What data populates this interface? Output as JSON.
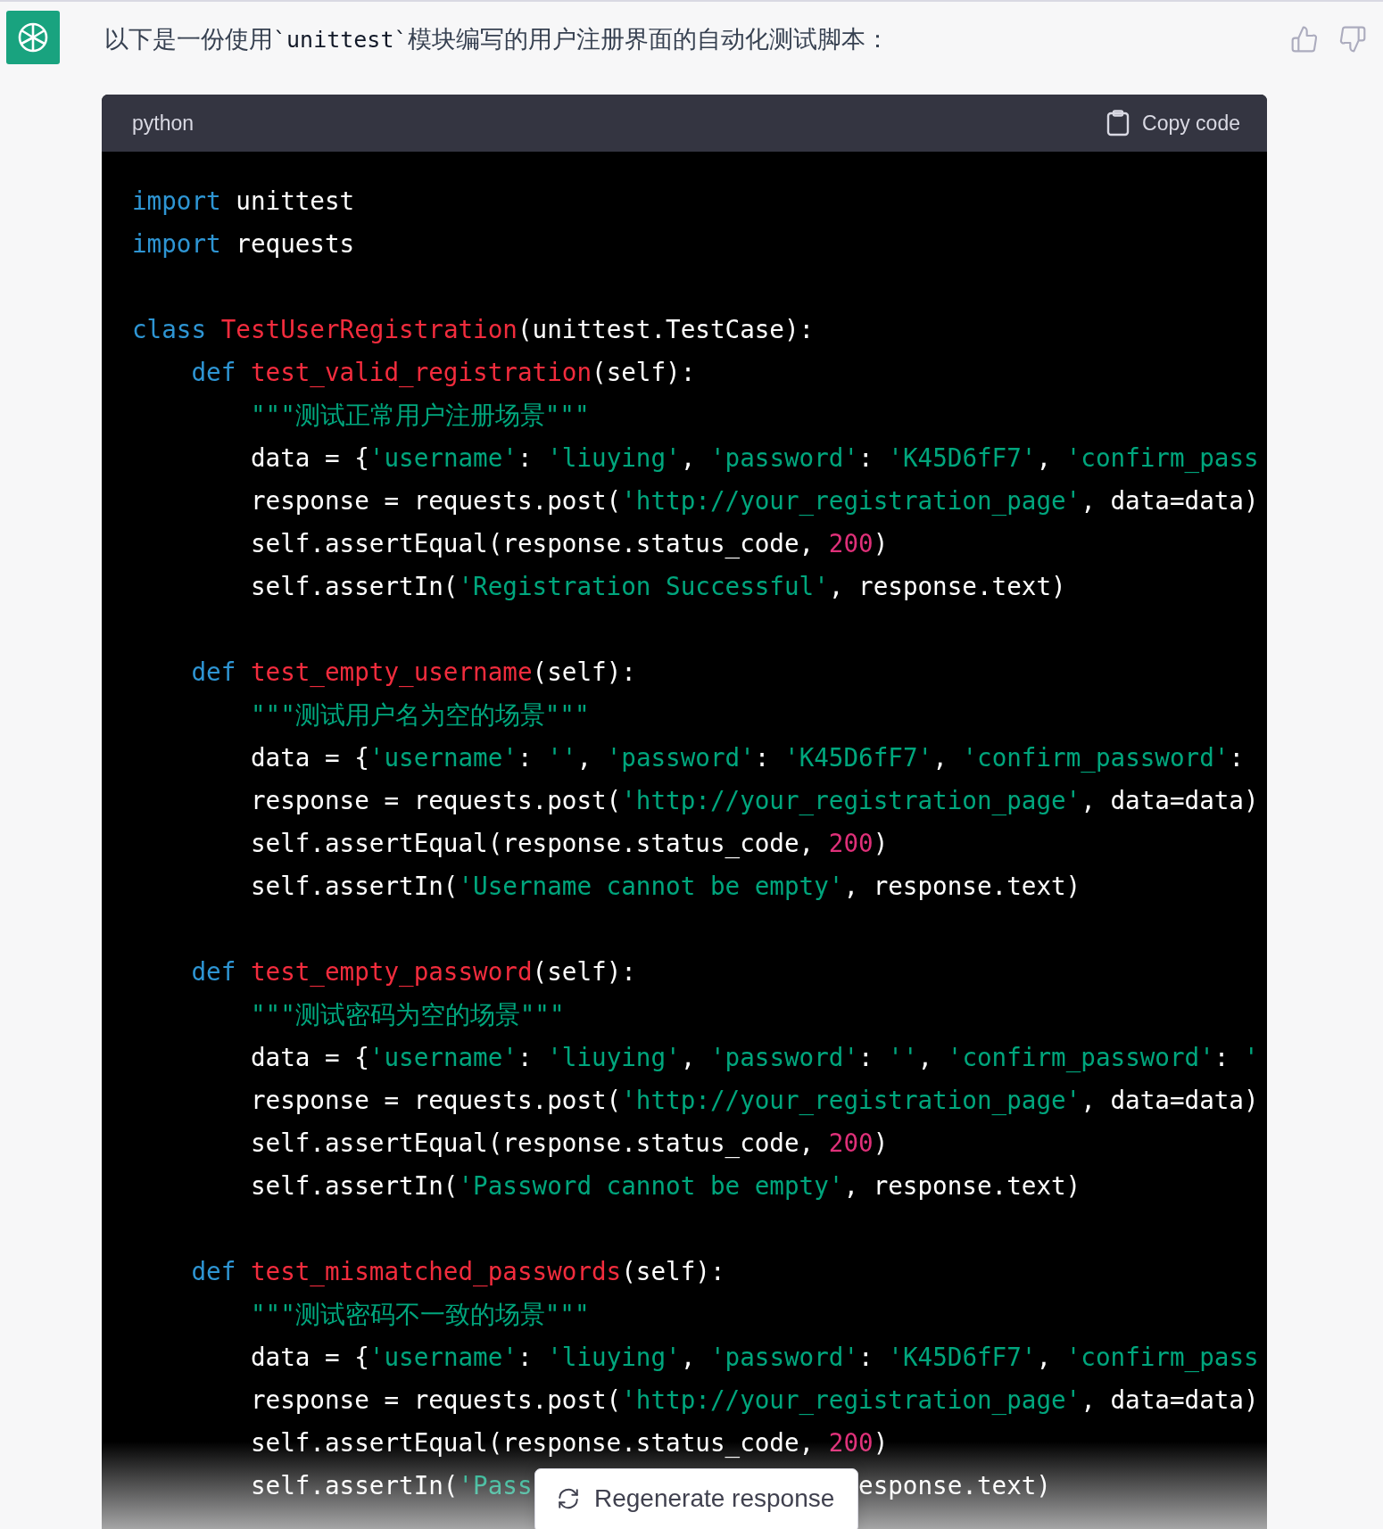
{
  "message": {
    "before": "以下是一份使用",
    "code": "`unittest`",
    "after": "模块编写的用户注册界面的自动化测试脚本："
  },
  "code_block": {
    "language": "python",
    "copy_label": "Copy code",
    "lines": [
      {
        "kind": "code",
        "tokens": [
          {
            "kind": "keyword",
            "text": "import"
          },
          {
            "kind": "plain",
            "text": " unittest"
          }
        ]
      },
      {
        "kind": "code",
        "tokens": [
          {
            "kind": "keyword",
            "text": "import"
          },
          {
            "kind": "plain",
            "text": " requests"
          }
        ]
      },
      {
        "kind": "blank"
      },
      {
        "kind": "code",
        "tokens": [
          {
            "kind": "keyword",
            "text": "class "
          },
          {
            "kind": "name",
            "text": "TestUserRegistration"
          },
          {
            "kind": "plain",
            "text": "(unittest.TestCase):"
          }
        ]
      },
      {
        "kind": "code",
        "tokens": [
          {
            "kind": "keyword",
            "text": "    def "
          },
          {
            "kind": "name",
            "text": "test_valid_registration"
          },
          {
            "kind": "plain",
            "text": "(self):"
          }
        ]
      },
      {
        "kind": "code",
        "tokens": [
          {
            "kind": "string",
            "text": "        \"\"\"测试正常用户注册场景\"\"\""
          }
        ]
      },
      {
        "kind": "code",
        "tokens": [
          {
            "kind": "plain",
            "text": "        data = {"
          },
          {
            "kind": "string",
            "text": "'username'"
          },
          {
            "kind": "plain",
            "text": ": "
          },
          {
            "kind": "string",
            "text": "'liuying'"
          },
          {
            "kind": "plain",
            "text": ", "
          },
          {
            "kind": "string",
            "text": "'password'"
          },
          {
            "kind": "plain",
            "text": ": "
          },
          {
            "kind": "string",
            "text": "'K45D6fF7'"
          },
          {
            "kind": "plain",
            "text": ", "
          },
          {
            "kind": "string",
            "text": "'confirm_pass"
          }
        ]
      },
      {
        "kind": "code",
        "tokens": [
          {
            "kind": "plain",
            "text": "        response = requests.post("
          },
          {
            "kind": "string",
            "text": "'http://your_registration_page'"
          },
          {
            "kind": "plain",
            "text": ", data=data)"
          }
        ]
      },
      {
        "kind": "code",
        "tokens": [
          {
            "kind": "plain",
            "text": "        self.assertEqual(response.status_code, "
          },
          {
            "kind": "number",
            "text": "200"
          },
          {
            "kind": "plain",
            "text": ")"
          }
        ]
      },
      {
        "kind": "code",
        "tokens": [
          {
            "kind": "plain",
            "text": "        self.assertIn("
          },
          {
            "kind": "string",
            "text": "'Registration Successful'"
          },
          {
            "kind": "plain",
            "text": ", response.text)"
          }
        ]
      },
      {
        "kind": "blank"
      },
      {
        "kind": "code",
        "tokens": [
          {
            "kind": "keyword",
            "text": "    def "
          },
          {
            "kind": "name",
            "text": "test_empty_username"
          },
          {
            "kind": "plain",
            "text": "(self):"
          }
        ]
      },
      {
        "kind": "code",
        "tokens": [
          {
            "kind": "string",
            "text": "        \"\"\"测试用户名为空的场景\"\"\""
          }
        ]
      },
      {
        "kind": "code",
        "tokens": [
          {
            "kind": "plain",
            "text": "        data = {"
          },
          {
            "kind": "string",
            "text": "'username'"
          },
          {
            "kind": "plain",
            "text": ": "
          },
          {
            "kind": "string",
            "text": "''"
          },
          {
            "kind": "plain",
            "text": ", "
          },
          {
            "kind": "string",
            "text": "'password'"
          },
          {
            "kind": "plain",
            "text": ": "
          },
          {
            "kind": "string",
            "text": "'K45D6fF7'"
          },
          {
            "kind": "plain",
            "text": ", "
          },
          {
            "kind": "string",
            "text": "'confirm_password'"
          },
          {
            "kind": "plain",
            "text": ":"
          }
        ]
      },
      {
        "kind": "code",
        "tokens": [
          {
            "kind": "plain",
            "text": "        response = requests.post("
          },
          {
            "kind": "string",
            "text": "'http://your_registration_page'"
          },
          {
            "kind": "plain",
            "text": ", data=data)"
          }
        ]
      },
      {
        "kind": "code",
        "tokens": [
          {
            "kind": "plain",
            "text": "        self.assertEqual(response.status_code, "
          },
          {
            "kind": "number",
            "text": "200"
          },
          {
            "kind": "plain",
            "text": ")"
          }
        ]
      },
      {
        "kind": "code",
        "tokens": [
          {
            "kind": "plain",
            "text": "        self.assertIn("
          },
          {
            "kind": "string",
            "text": "'Username cannot be empty'"
          },
          {
            "kind": "plain",
            "text": ", response.text)"
          }
        ]
      },
      {
        "kind": "blank"
      },
      {
        "kind": "code",
        "tokens": [
          {
            "kind": "keyword",
            "text": "    def "
          },
          {
            "kind": "name",
            "text": "test_empty_password"
          },
          {
            "kind": "plain",
            "text": "(self):"
          }
        ]
      },
      {
        "kind": "code",
        "tokens": [
          {
            "kind": "string",
            "text": "        \"\"\"测试密码为空的场景\"\"\""
          }
        ]
      },
      {
        "kind": "code",
        "tokens": [
          {
            "kind": "plain",
            "text": "        data = {"
          },
          {
            "kind": "string",
            "text": "'username'"
          },
          {
            "kind": "plain",
            "text": ": "
          },
          {
            "kind": "string",
            "text": "'liuying'"
          },
          {
            "kind": "plain",
            "text": ", "
          },
          {
            "kind": "string",
            "text": "'password'"
          },
          {
            "kind": "plain",
            "text": ": "
          },
          {
            "kind": "string",
            "text": "''"
          },
          {
            "kind": "plain",
            "text": ", "
          },
          {
            "kind": "string",
            "text": "'confirm_password'"
          },
          {
            "kind": "plain",
            "text": ": "
          },
          {
            "kind": "string",
            "text": "'"
          }
        ]
      },
      {
        "kind": "code",
        "tokens": [
          {
            "kind": "plain",
            "text": "        response = requests.post("
          },
          {
            "kind": "string",
            "text": "'http://your_registration_page'"
          },
          {
            "kind": "plain",
            "text": ", data=data)"
          }
        ]
      },
      {
        "kind": "code",
        "tokens": [
          {
            "kind": "plain",
            "text": "        self.assertEqual(response.status_code, "
          },
          {
            "kind": "number",
            "text": "200"
          },
          {
            "kind": "plain",
            "text": ")"
          }
        ]
      },
      {
        "kind": "code",
        "tokens": [
          {
            "kind": "plain",
            "text": "        self.assertIn("
          },
          {
            "kind": "string",
            "text": "'Password cannot be empty'"
          },
          {
            "kind": "plain",
            "text": ", response.text)"
          }
        ]
      },
      {
        "kind": "blank"
      },
      {
        "kind": "code",
        "tokens": [
          {
            "kind": "keyword",
            "text": "    def "
          },
          {
            "kind": "name",
            "text": "test_mismatched_passwords"
          },
          {
            "kind": "plain",
            "text": "(self):"
          }
        ]
      },
      {
        "kind": "code",
        "tokens": [
          {
            "kind": "string",
            "text": "        \"\"\"测试密码不一致的场景\"\"\""
          }
        ]
      },
      {
        "kind": "code",
        "tokens": [
          {
            "kind": "plain",
            "text": "        data = {"
          },
          {
            "kind": "string",
            "text": "'username'"
          },
          {
            "kind": "plain",
            "text": ": "
          },
          {
            "kind": "string",
            "text": "'liuying'"
          },
          {
            "kind": "plain",
            "text": ", "
          },
          {
            "kind": "string",
            "text": "'password'"
          },
          {
            "kind": "plain",
            "text": ": "
          },
          {
            "kind": "string",
            "text": "'K45D6fF7'"
          },
          {
            "kind": "plain",
            "text": ", "
          },
          {
            "kind": "string",
            "text": "'confirm_pass"
          }
        ]
      },
      {
        "kind": "code",
        "tokens": [
          {
            "kind": "plain",
            "text": "        response = requests.post("
          },
          {
            "kind": "string",
            "text": "'http://your_registration_page'"
          },
          {
            "kind": "plain",
            "text": ", data=data)"
          }
        ]
      },
      {
        "kind": "code",
        "tokens": [
          {
            "kind": "plain",
            "text": "        self.assertEqual(response.status_code, "
          },
          {
            "kind": "number",
            "text": "200"
          },
          {
            "kind": "plain",
            "text": ")"
          }
        ]
      },
      {
        "kind": "covered",
        "tokens": [
          {
            "kind": "plain",
            "text": "        self.assertIn("
          },
          {
            "kind": "string",
            "text": "'Pass"
          }
        ],
        "tail": [
          {
            "kind": "plain",
            "text": "esponse.text)"
          }
        ]
      }
    ]
  },
  "regenerate_button": {
    "label": "Regenerate response"
  }
}
